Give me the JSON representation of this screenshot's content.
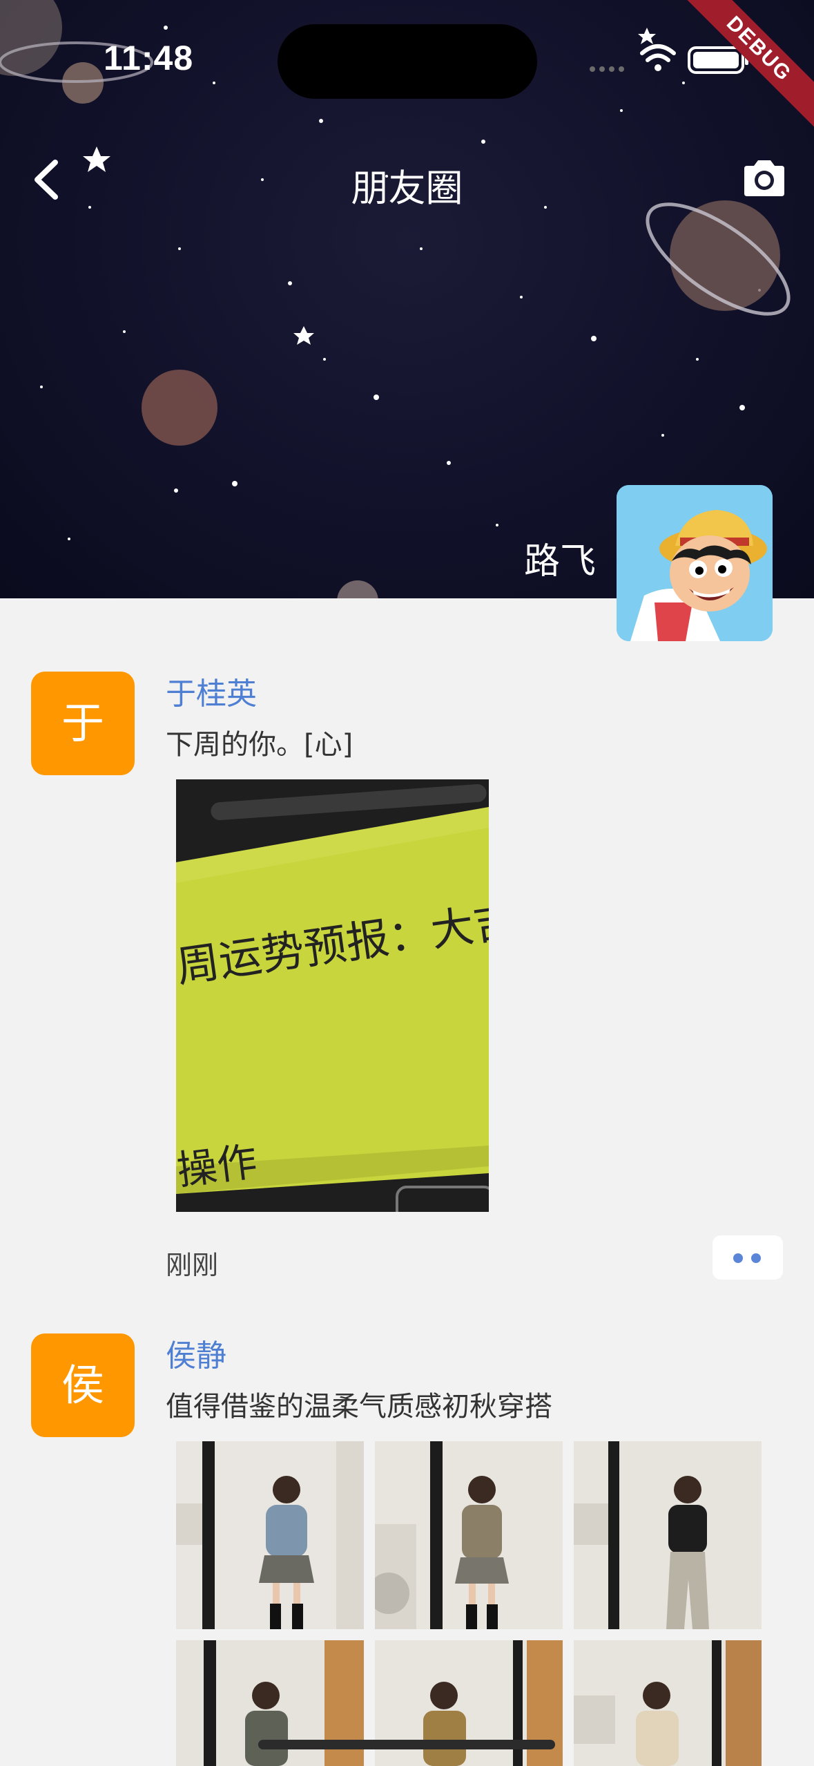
{
  "status_bar": {
    "time": "11:48",
    "debug_badge": "DEBUG"
  },
  "header": {
    "title": "朋友圈",
    "back_icon": "chevron-left-icon",
    "camera_icon": "camera-icon"
  },
  "profile": {
    "name": "路飞"
  },
  "posts": [
    {
      "avatar_letter": "于",
      "author": "于桂英",
      "text": "下周的你。[心]",
      "image": {
        "line1": "周运势预报：大吉",
        "line2": "操作"
      },
      "time": "刚刚"
    },
    {
      "avatar_letter": "侯",
      "author": "侯静",
      "text": "值得借鉴的温柔气质感初秋穿搭",
      "photo_count_visible": 6
    }
  ],
  "colors": {
    "accent": "#ff9800",
    "link": "#4f7fd3",
    "background": "#f2f2f2",
    "ribbon": "#a01d2c"
  }
}
